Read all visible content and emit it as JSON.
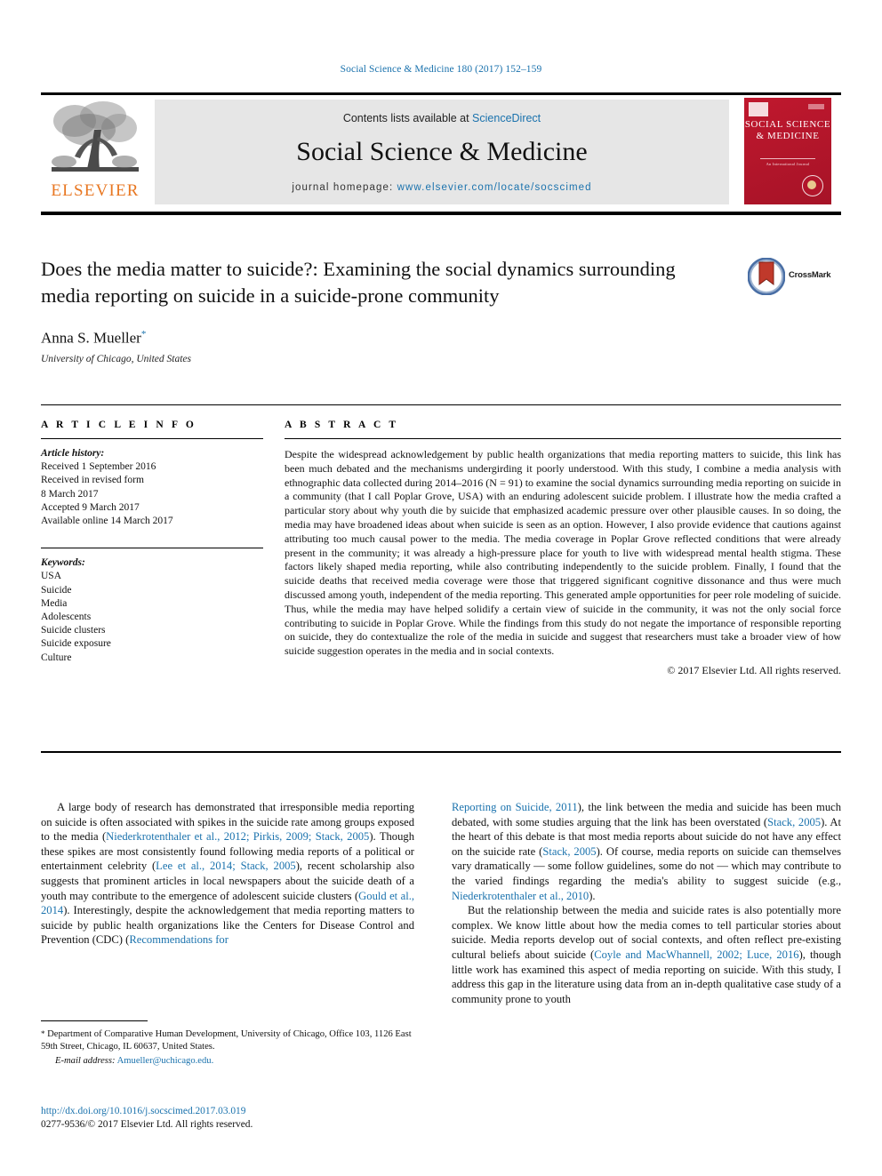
{
  "running_head": "Social Science & Medicine 180 (2017) 152–159",
  "masthead": {
    "contents_prefix": "Contents lists available at ",
    "sciencedirect": "ScienceDirect",
    "journal_name": "Social Science & Medicine",
    "homepage_prefix": "journal homepage: ",
    "homepage_url": "www.elsevier.com/locate/socscimed",
    "publisher": "ELSEVIER",
    "cover": {
      "title": "SOCIAL SCIENCE & MEDICINE",
      "subtitle": "An International Journal"
    }
  },
  "article": {
    "title": "Does the media matter to suicide?: Examining the social dynamics surrounding media reporting on suicide in a suicide-prone community",
    "author": "Anna S. Mueller",
    "author_marker": "*",
    "affiliation": "University of Chicago, United States",
    "crossmark_label": "CrossMark"
  },
  "article_info": {
    "heading": "A R T I C L E   I N F O",
    "history_label": "Article history:",
    "history": [
      "Received 1 September 2016",
      "Received in revised form",
      "8 March 2017",
      "Accepted 9 March 2017",
      "Available online 14 March 2017"
    ],
    "keywords_label": "Keywords:",
    "keywords": [
      "USA",
      "Suicide",
      "Media",
      "Adolescents",
      "Suicide clusters",
      "Suicide exposure",
      "Culture"
    ]
  },
  "abstract": {
    "heading": "A B S T R A C T",
    "text": "Despite the widespread acknowledgement by public health organizations that media reporting matters to suicide, this link has been much debated and the mechanisms undergirding it poorly understood. With this study, I combine a media analysis with ethnographic data collected during 2014–2016 (N = 91) to examine the social dynamics surrounding media reporting on suicide in a community (that I call Poplar Grove, USA) with an enduring adolescent suicide problem. I illustrate how the media crafted a particular story about why youth die by suicide that emphasized academic pressure over other plausible causes. In so doing, the media may have broadened ideas about when suicide is seen as an option. However, I also provide evidence that cautions against attributing too much causal power to the media. The media coverage in Poplar Grove reflected conditions that were already present in the community; it was already a high-pressure place for youth to live with widespread mental health stigma. These factors likely shaped media reporting, while also contributing independently to the suicide problem. Finally, I found that the suicide deaths that received media coverage were those that triggered significant cognitive dissonance and thus were much discussed among youth, independent of the media reporting. This generated ample opportunities for peer role modeling of suicide. Thus, while the media may have helped solidify a certain view of suicide in the community, it was not the only social force contributing to suicide in Poplar Grove. While the findings from this study do not negate the importance of responsible reporting on suicide, they do contextualize the role of the media in suicide and suggest that researchers must take a broader view of how suicide suggestion operates in the media and in social contexts.",
    "copyright": "© 2017 Elsevier Ltd. All rights reserved."
  },
  "body": {
    "left_column": [
      {
        "runs": [
          {
            "t": "A large body of research has demonstrated that irresponsible media reporting on suicide is often associated with spikes in the suicide rate among groups exposed to the media (",
            "link": false
          },
          {
            "t": "Niederkrotenthaler et al., 2012; Pirkis, 2009; Stack, 2005",
            "link": true
          },
          {
            "t": "). Though these spikes are most consistently found following media reports of a political or entertainment celebrity (",
            "link": false
          },
          {
            "t": "Lee et al., 2014; Stack, 2005",
            "link": true
          },
          {
            "t": "), recent scholarship also suggests that prominent articles in local newspapers about the suicide death of a youth may contribute to the emergence of adolescent suicide clusters (",
            "link": false
          },
          {
            "t": "Gould et al., 2014",
            "link": true
          },
          {
            "t": "). Interestingly, despite the acknowledgement that media reporting matters to suicide by public health organizations like the Centers for Disease Control and Prevention (CDC) (",
            "link": false
          },
          {
            "t": "Recommendations for",
            "link": true
          }
        ]
      }
    ],
    "right_column": [
      {
        "runs": [
          {
            "t": "Reporting on Suicide, 2011",
            "link": true
          },
          {
            "t": "), the link between the media and suicide has been much debated, with some studies arguing that the link has been overstated (",
            "link": false
          },
          {
            "t": "Stack, 2005",
            "link": true
          },
          {
            "t": "). At the heart of this debate is that most media reports about suicide do not have any effect on the suicide rate (",
            "link": false
          },
          {
            "t": "Stack, 2005",
            "link": true
          },
          {
            "t": "). Of course, media reports on suicide can themselves vary dramatically — some follow guidelines, some do not — which may contribute to the varied findings regarding the media's ability to suggest suicide (e.g., ",
            "link": false
          },
          {
            "t": "Niederkrotenthaler et al., 2010",
            "link": true
          },
          {
            "t": ").",
            "link": false
          }
        ],
        "indent": false
      },
      {
        "runs": [
          {
            "t": "But the relationship between the media and suicide rates is also potentially more complex. We know little about how the media comes to tell particular stories about suicide. Media reports develop out of social contexts, and often reflect pre-existing cultural beliefs about suicide (",
            "link": false
          },
          {
            "t": "Coyle and MacWhannell, 2002; Luce, 2016",
            "link": true
          },
          {
            "t": "), though little work has examined this aspect of media reporting on suicide. With this study, I address this gap in the literature using data from an in-depth qualitative case study of a community prone to youth",
            "link": false
          }
        ],
        "indent": true
      }
    ]
  },
  "footnote": {
    "marker": "*",
    "text": "Department of Comparative Human Development, University of Chicago, Office 103, 1126 East 59th Street, Chicago, IL 60637, United States.",
    "email_label": "E-mail address:",
    "email": "Amueller@uchicago.edu."
  },
  "footer": {
    "doi": "http://dx.doi.org/10.1016/j.socscimed.2017.03.019",
    "issn_line": "0277-9536/© 2017 Elsevier Ltd. All rights reserved."
  },
  "colors": {
    "link_blue": "#1a72ad",
    "elsevier_orange": "#e87722",
    "cover_red": "#b2152b",
    "band_grey": "#e6e6e6"
  }
}
